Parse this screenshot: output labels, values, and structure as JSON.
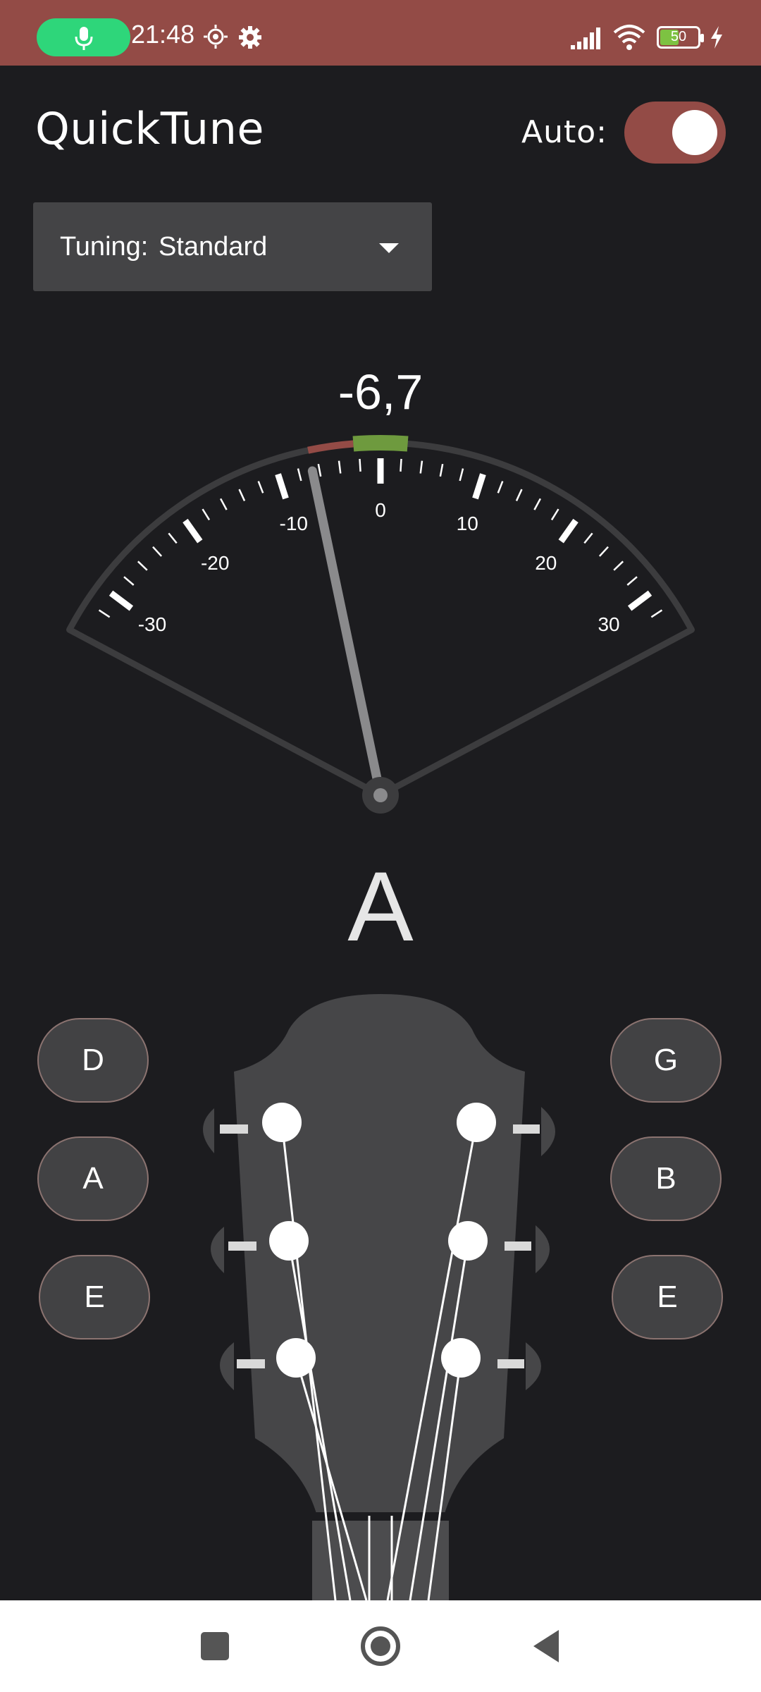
{
  "status_bar": {
    "time": "21:48",
    "battery_level": "50",
    "icons": [
      "mic-icon",
      "brightness-icon",
      "settings-icon",
      "signal-icon",
      "wifi-icon",
      "battery-icon",
      "charging-icon"
    ],
    "background_color": "#934b46",
    "mic_pill_color": "#2ed67a"
  },
  "header": {
    "title": "QuickTune",
    "auto_label": "Auto:",
    "auto_enabled": true
  },
  "tuning": {
    "prefix": "Tuning:",
    "value": "Standard"
  },
  "gauge": {
    "cents": "-6,7",
    "cents_value": -6.7,
    "range": [
      -35,
      35
    ],
    "labels": [
      "-30",
      "-20",
      "-10",
      "0",
      "10",
      "20",
      "30"
    ],
    "in_tune_color": "#6e9a3e",
    "deviation_color": "#934b46"
  },
  "note": "A",
  "strings": {
    "left": [
      "D",
      "A",
      "E"
    ],
    "right": [
      "G",
      "B",
      "E"
    ]
  },
  "nav": {
    "icons": [
      "recents-square-icon",
      "home-circle-icon",
      "back-triangle-icon"
    ]
  }
}
